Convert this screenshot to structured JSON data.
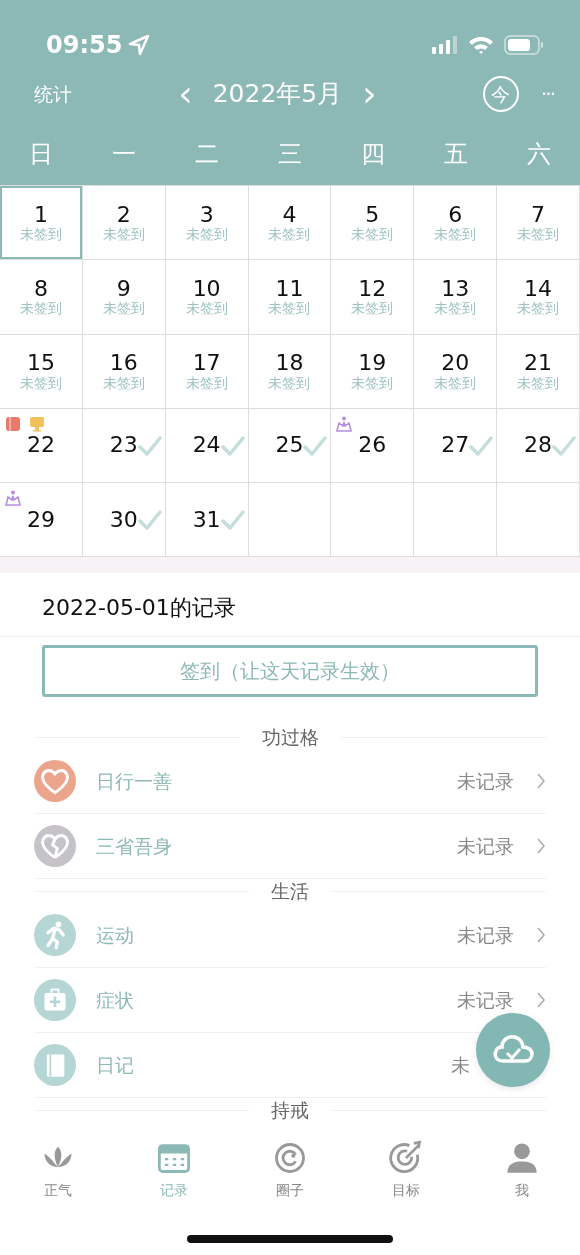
{
  "status_bar": {
    "time": "09:55"
  },
  "nav": {
    "left": "统计",
    "month": "2022年5月",
    "prev": "‹",
    "next": "›",
    "today": "今",
    "more": "···"
  },
  "weekdays": [
    "日",
    "一",
    "二",
    "三",
    "四",
    "五",
    "六"
  ],
  "days": [
    {
      "day": "1",
      "sub": "未签到",
      "checked": false,
      "selected": true
    },
    {
      "day": "2",
      "sub": "未签到",
      "checked": false,
      "selected": false
    },
    {
      "day": "3",
      "sub": "未签到",
      "checked": false,
      "selected": false
    },
    {
      "day": "4",
      "sub": "未签到",
      "checked": false,
      "selected": false
    },
    {
      "day": "5",
      "sub": "未签到",
      "checked": false,
      "selected": false
    },
    {
      "day": "6",
      "sub": "未签到",
      "checked": false,
      "selected": false
    },
    {
      "day": "7",
      "sub": "未签到",
      "checked": false,
      "selected": false
    },
    {
      "day": "8",
      "sub": "未签到",
      "checked": false,
      "selected": false
    },
    {
      "day": "9",
      "sub": "未签到",
      "checked": false,
      "selected": false
    },
    {
      "day": "10",
      "sub": "未签到",
      "checked": false,
      "selected": false
    },
    {
      "day": "11",
      "sub": "未签到",
      "checked": false,
      "selected": false
    },
    {
      "day": "12",
      "sub": "未签到",
      "checked": false,
      "selected": false
    },
    {
      "day": "13",
      "sub": "未签到",
      "checked": false,
      "selected": false
    },
    {
      "day": "14",
      "sub": "未签到",
      "checked": false,
      "selected": false
    },
    {
      "day": "15",
      "sub": "未签到",
      "checked": false,
      "selected": false
    },
    {
      "day": "16",
      "sub": "未签到",
      "checked": false,
      "selected": false
    },
    {
      "day": "17",
      "sub": "未签到",
      "checked": false,
      "selected": false
    },
    {
      "day": "18",
      "sub": "未签到",
      "checked": false,
      "selected": false
    },
    {
      "day": "19",
      "sub": "未签到",
      "checked": false,
      "selected": false
    },
    {
      "day": "20",
      "sub": "未签到",
      "checked": false,
      "selected": false
    },
    {
      "day": "21",
      "sub": "未签到",
      "checked": false,
      "selected": false
    },
    {
      "day": "22",
      "checked": false,
      "selected": false,
      "markers": [
        {
          "kind": "book"
        },
        {
          "kind": "monitor"
        }
      ]
    },
    {
      "day": "23",
      "checked": true,
      "selected": false
    },
    {
      "day": "24",
      "checked": true,
      "selected": false
    },
    {
      "day": "25",
      "checked": true,
      "selected": false
    },
    {
      "day": "26",
      "checked": false,
      "selected": false,
      "markers": [
        {
          "kind": "meditation"
        }
      ]
    },
    {
      "day": "27",
      "checked": true,
      "selected": false
    },
    {
      "day": "28",
      "checked": true,
      "selected": false
    },
    {
      "day": "29",
      "checked": false,
      "selected": false,
      "markers": [
        {
          "kind": "meditation"
        }
      ]
    },
    {
      "day": "30",
      "checked": true,
      "selected": false
    },
    {
      "day": "31",
      "checked": true,
      "selected": false
    }
  ],
  "record": {
    "title": "2022-05-01的记录",
    "checkin_button": "签到（让这天记录生效）"
  },
  "sections": [
    {
      "title": "功过格",
      "items": [
        {
          "label": "日行一善",
          "status": "未记录",
          "kind": "heart",
          "color": "#eba58d",
          "chevron": true
        },
        {
          "label": "三省吾身",
          "status": "未记录",
          "kind": "broken-heart",
          "color": "#c5c3c8",
          "chevron": true
        }
      ]
    },
    {
      "title": "生活",
      "items": [
        {
          "label": "运动",
          "status": "未记录",
          "kind": "runner",
          "color": "#b5d6d4",
          "chevron": true
        },
        {
          "label": "症状",
          "status": "未记录",
          "kind": "medkit",
          "color": "#b5d6d4",
          "chevron": true
        },
        {
          "label": "日记",
          "status": "未",
          "kind": "notebook",
          "color": "#b5d6d4",
          "chevron": false
        }
      ]
    },
    {
      "title": "持戒"
    }
  ],
  "tabs": [
    {
      "label": "正气",
      "kind": "lotus",
      "selected": false
    },
    {
      "label": "记录",
      "kind": "calendar",
      "selected": true
    },
    {
      "label": "圈子",
      "kind": "ring",
      "selected": false
    },
    {
      "label": "目标",
      "kind": "target",
      "selected": false
    },
    {
      "label": "我",
      "kind": "person",
      "selected": false
    }
  ]
}
